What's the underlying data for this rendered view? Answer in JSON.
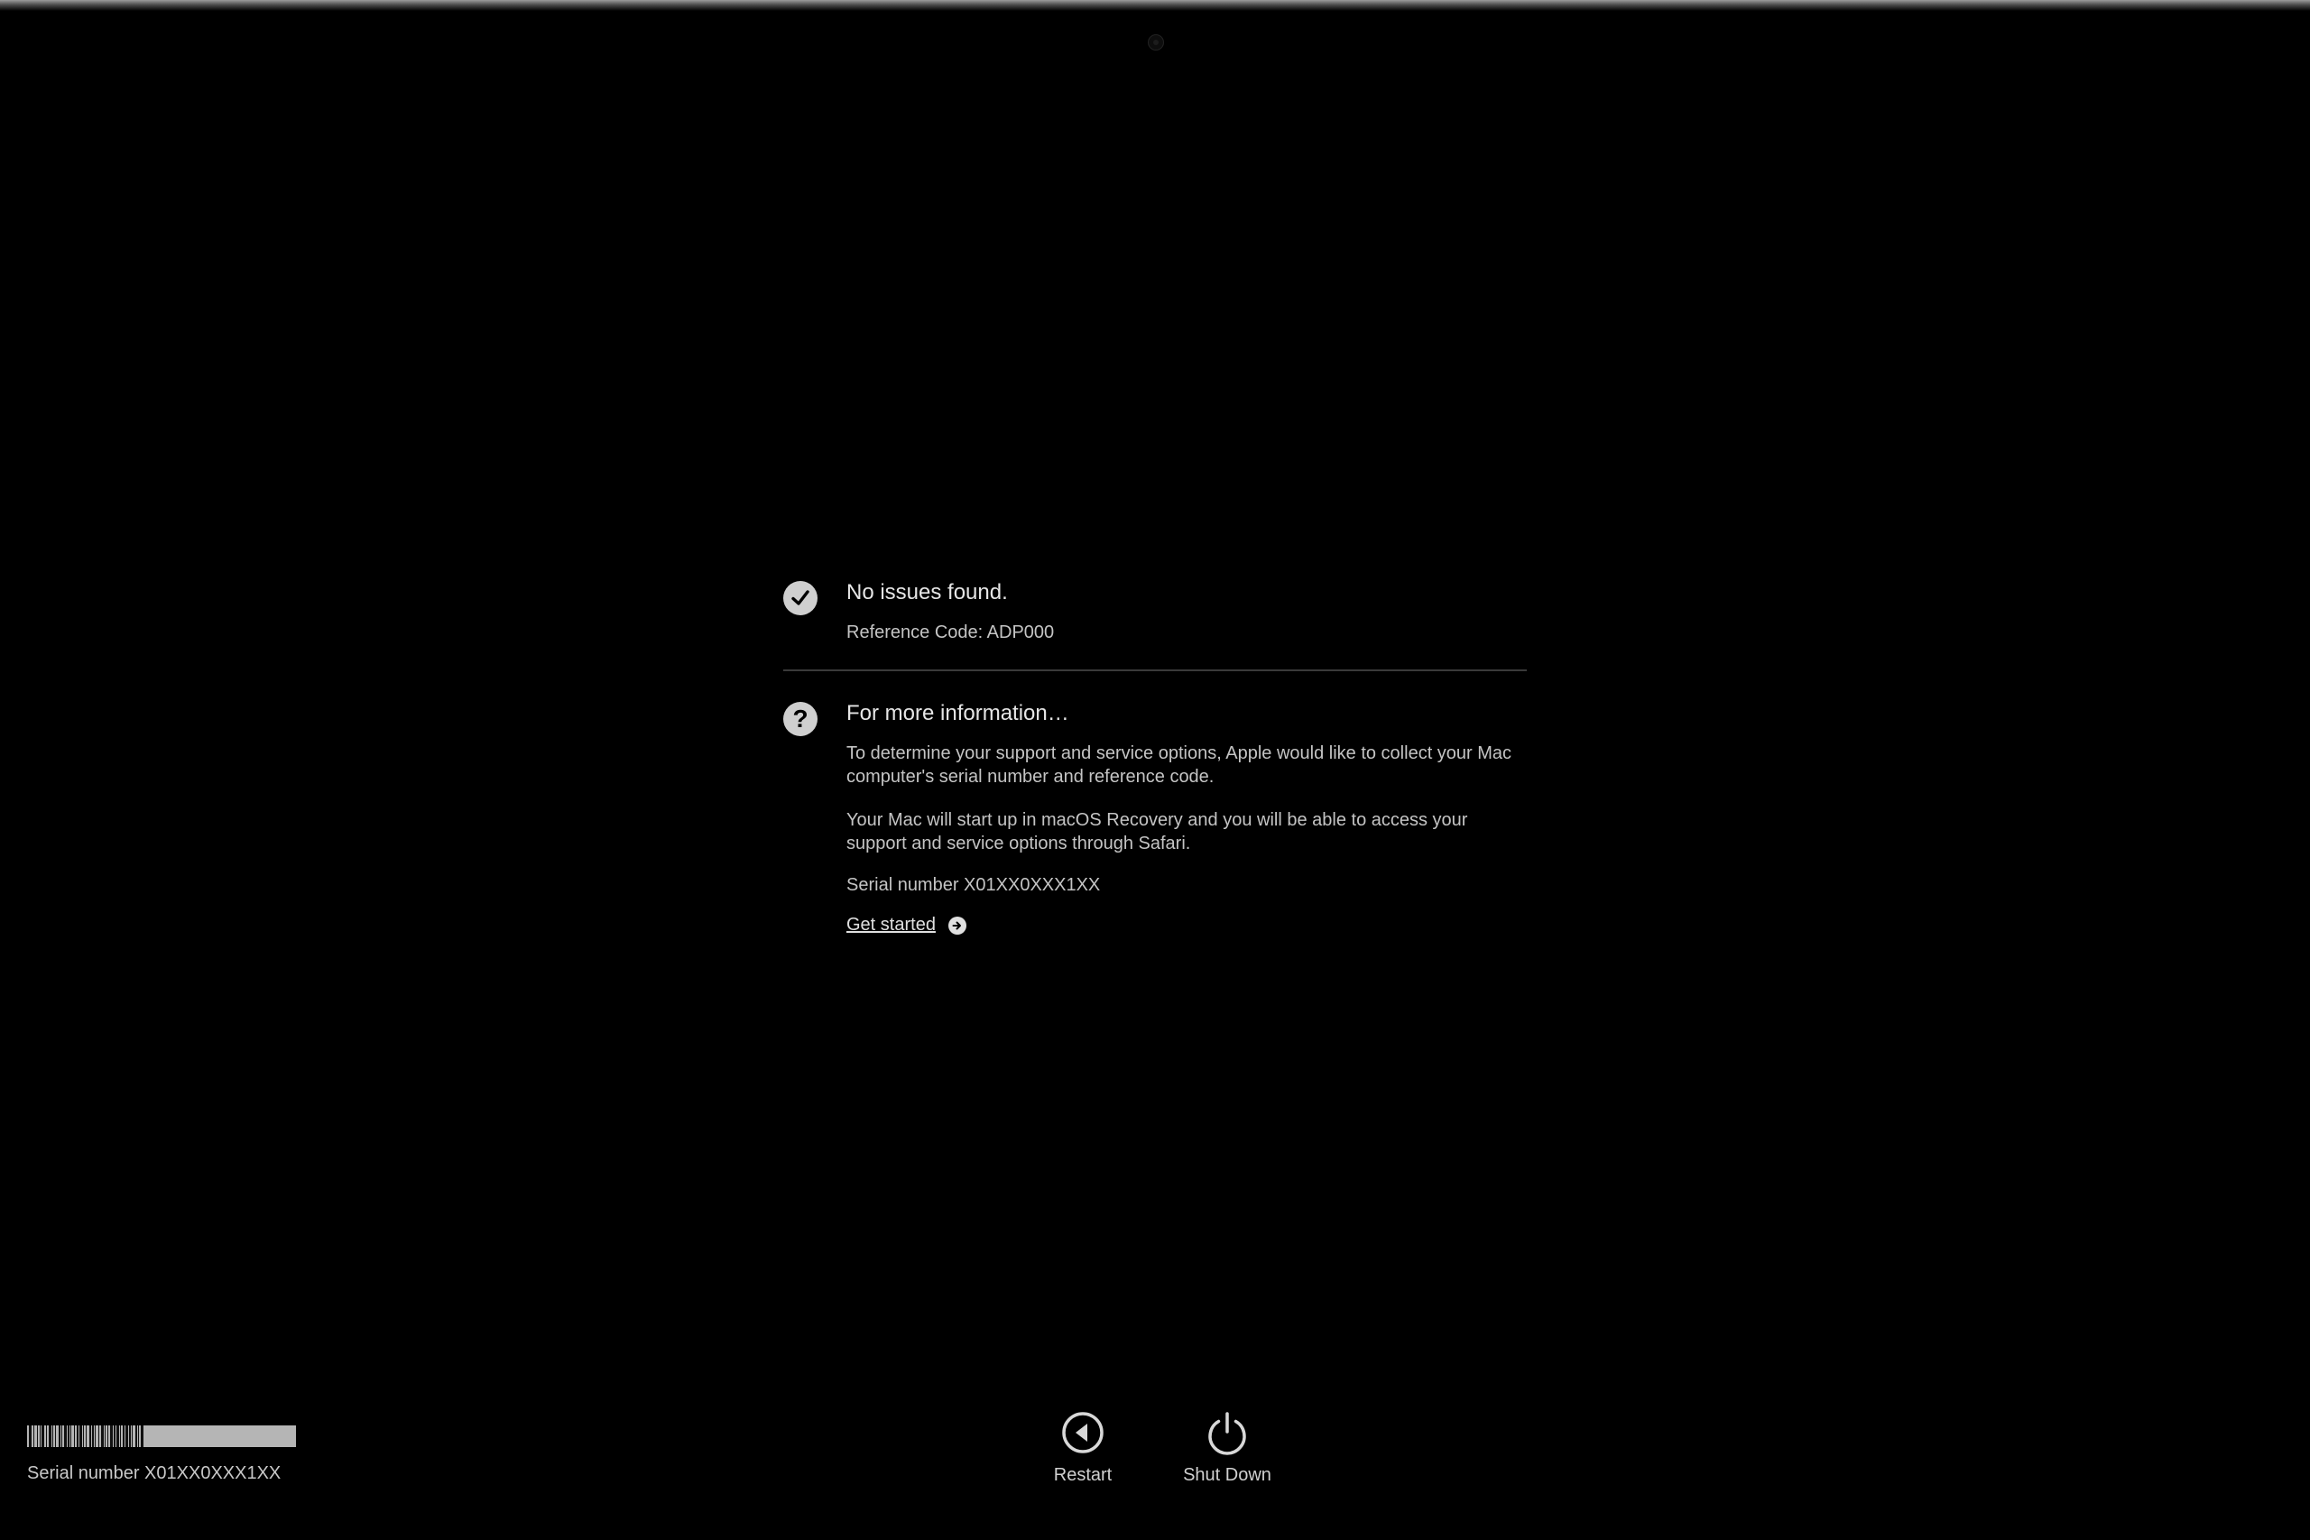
{
  "result": {
    "heading": "No issues found.",
    "reference_code": "Reference Code: ADP000",
    "icon": "checkmark-circle-icon"
  },
  "info": {
    "heading": "For more information…",
    "icon": "question-circle-icon",
    "paragraph_1": "To determine your support and service options, Apple would like to collect your Mac computer's serial number and reference code.",
    "paragraph_2": "Your Mac will start up in macOS Recovery and you will be able to access your support and service options through Safari.",
    "serial_number": "Serial number X01XX0XXX1XX",
    "link_label": "Get started",
    "link_icon": "arrow-right-circle-icon"
  },
  "footer": {
    "serial_number": "Serial number X01XX0XXX1XX",
    "barcode_icon": "barcode-icon"
  },
  "controls": {
    "restart_label": "Restart",
    "restart_icon": "restart-icon",
    "shutdown_label": "Shut Down",
    "shutdown_icon": "power-icon"
  },
  "colors": {
    "background": "#000000",
    "text": "#d8d8d8",
    "icon_fill": "#cfcfcf",
    "divider": "#3a3a3a"
  }
}
